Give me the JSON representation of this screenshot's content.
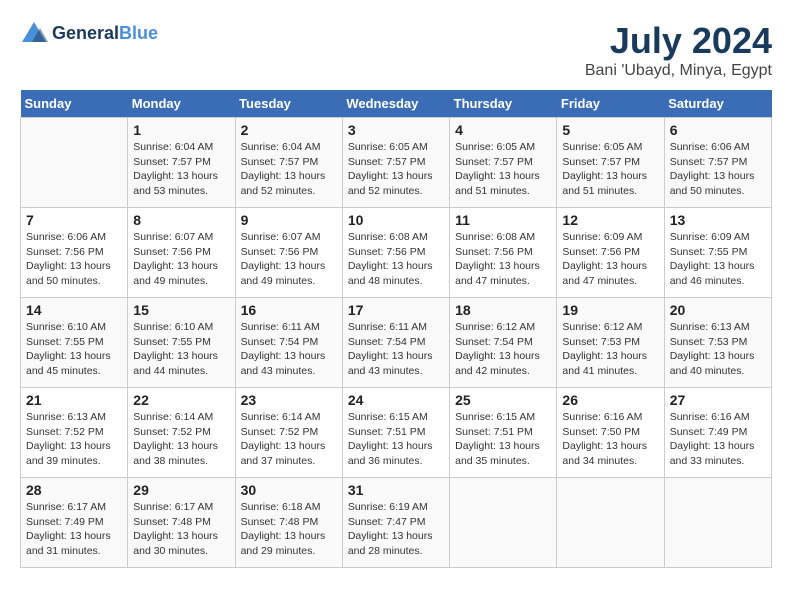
{
  "header": {
    "logo_line1": "General",
    "logo_line2": "Blue",
    "month_year": "July 2024",
    "location": "Bani 'Ubayd, Minya, Egypt"
  },
  "days_of_week": [
    "Sunday",
    "Monday",
    "Tuesday",
    "Wednesday",
    "Thursday",
    "Friday",
    "Saturday"
  ],
  "weeks": [
    [
      {
        "day": "",
        "info": ""
      },
      {
        "day": "1",
        "info": "Sunrise: 6:04 AM\nSunset: 7:57 PM\nDaylight: 13 hours\nand 53 minutes."
      },
      {
        "day": "2",
        "info": "Sunrise: 6:04 AM\nSunset: 7:57 PM\nDaylight: 13 hours\nand 52 minutes."
      },
      {
        "day": "3",
        "info": "Sunrise: 6:05 AM\nSunset: 7:57 PM\nDaylight: 13 hours\nand 52 minutes."
      },
      {
        "day": "4",
        "info": "Sunrise: 6:05 AM\nSunset: 7:57 PM\nDaylight: 13 hours\nand 51 minutes."
      },
      {
        "day": "5",
        "info": "Sunrise: 6:05 AM\nSunset: 7:57 PM\nDaylight: 13 hours\nand 51 minutes."
      },
      {
        "day": "6",
        "info": "Sunrise: 6:06 AM\nSunset: 7:57 PM\nDaylight: 13 hours\nand 50 minutes."
      }
    ],
    [
      {
        "day": "7",
        "info": "Sunrise: 6:06 AM\nSunset: 7:56 PM\nDaylight: 13 hours\nand 50 minutes."
      },
      {
        "day": "8",
        "info": "Sunrise: 6:07 AM\nSunset: 7:56 PM\nDaylight: 13 hours\nand 49 minutes."
      },
      {
        "day": "9",
        "info": "Sunrise: 6:07 AM\nSunset: 7:56 PM\nDaylight: 13 hours\nand 49 minutes."
      },
      {
        "day": "10",
        "info": "Sunrise: 6:08 AM\nSunset: 7:56 PM\nDaylight: 13 hours\nand 48 minutes."
      },
      {
        "day": "11",
        "info": "Sunrise: 6:08 AM\nSunset: 7:56 PM\nDaylight: 13 hours\nand 47 minutes."
      },
      {
        "day": "12",
        "info": "Sunrise: 6:09 AM\nSunset: 7:56 PM\nDaylight: 13 hours\nand 47 minutes."
      },
      {
        "day": "13",
        "info": "Sunrise: 6:09 AM\nSunset: 7:55 PM\nDaylight: 13 hours\nand 46 minutes."
      }
    ],
    [
      {
        "day": "14",
        "info": "Sunrise: 6:10 AM\nSunset: 7:55 PM\nDaylight: 13 hours\nand 45 minutes."
      },
      {
        "day": "15",
        "info": "Sunrise: 6:10 AM\nSunset: 7:55 PM\nDaylight: 13 hours\nand 44 minutes."
      },
      {
        "day": "16",
        "info": "Sunrise: 6:11 AM\nSunset: 7:54 PM\nDaylight: 13 hours\nand 43 minutes."
      },
      {
        "day": "17",
        "info": "Sunrise: 6:11 AM\nSunset: 7:54 PM\nDaylight: 13 hours\nand 43 minutes."
      },
      {
        "day": "18",
        "info": "Sunrise: 6:12 AM\nSunset: 7:54 PM\nDaylight: 13 hours\nand 42 minutes."
      },
      {
        "day": "19",
        "info": "Sunrise: 6:12 AM\nSunset: 7:53 PM\nDaylight: 13 hours\nand 41 minutes."
      },
      {
        "day": "20",
        "info": "Sunrise: 6:13 AM\nSunset: 7:53 PM\nDaylight: 13 hours\nand 40 minutes."
      }
    ],
    [
      {
        "day": "21",
        "info": "Sunrise: 6:13 AM\nSunset: 7:52 PM\nDaylight: 13 hours\nand 39 minutes."
      },
      {
        "day": "22",
        "info": "Sunrise: 6:14 AM\nSunset: 7:52 PM\nDaylight: 13 hours\nand 38 minutes."
      },
      {
        "day": "23",
        "info": "Sunrise: 6:14 AM\nSunset: 7:52 PM\nDaylight: 13 hours\nand 37 minutes."
      },
      {
        "day": "24",
        "info": "Sunrise: 6:15 AM\nSunset: 7:51 PM\nDaylight: 13 hours\nand 36 minutes."
      },
      {
        "day": "25",
        "info": "Sunrise: 6:15 AM\nSunset: 7:51 PM\nDaylight: 13 hours\nand 35 minutes."
      },
      {
        "day": "26",
        "info": "Sunrise: 6:16 AM\nSunset: 7:50 PM\nDaylight: 13 hours\nand 34 minutes."
      },
      {
        "day": "27",
        "info": "Sunrise: 6:16 AM\nSunset: 7:49 PM\nDaylight: 13 hours\nand 33 minutes."
      }
    ],
    [
      {
        "day": "28",
        "info": "Sunrise: 6:17 AM\nSunset: 7:49 PM\nDaylight: 13 hours\nand 31 minutes."
      },
      {
        "day": "29",
        "info": "Sunrise: 6:17 AM\nSunset: 7:48 PM\nDaylight: 13 hours\nand 30 minutes."
      },
      {
        "day": "30",
        "info": "Sunrise: 6:18 AM\nSunset: 7:48 PM\nDaylight: 13 hours\nand 29 minutes."
      },
      {
        "day": "31",
        "info": "Sunrise: 6:19 AM\nSunset: 7:47 PM\nDaylight: 13 hours\nand 28 minutes."
      },
      {
        "day": "",
        "info": ""
      },
      {
        "day": "",
        "info": ""
      },
      {
        "day": "",
        "info": ""
      }
    ]
  ]
}
